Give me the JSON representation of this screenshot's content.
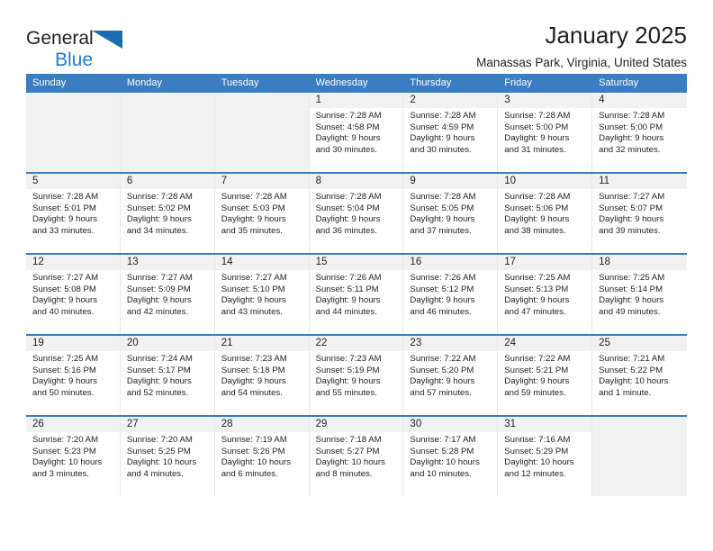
{
  "brand": {
    "name_primary": "General",
    "name_secondary": "Blue",
    "triangle_icon": "triangle-icon",
    "accent_color": "#1b7fd4"
  },
  "header": {
    "title": "January 2025",
    "subtitle": "Manassas Park, Virginia, United States"
  },
  "theme": {
    "header_bar_color": "#3b7dc0",
    "day_number_band_color": "#f1f1f1",
    "empty_cell_color": "#f1f1f1",
    "text_color": "#231f20"
  },
  "calendar": {
    "weekdays": [
      "Sunday",
      "Monday",
      "Tuesday",
      "Wednesday",
      "Thursday",
      "Friday",
      "Saturday"
    ],
    "labels": {
      "sunrise": "Sunrise:",
      "sunset": "Sunset:",
      "daylight": "Daylight:"
    },
    "weeks": [
      [
        {
          "empty": true
        },
        {
          "empty": true
        },
        {
          "empty": true
        },
        {
          "day": "1",
          "sunrise": "Sunrise: 7:28 AM",
          "sunset": "Sunset: 4:58 PM",
          "daylight_line1": "Daylight: 9 hours",
          "daylight_line2": "and 30 minutes."
        },
        {
          "day": "2",
          "sunrise": "Sunrise: 7:28 AM",
          "sunset": "Sunset: 4:59 PM",
          "daylight_line1": "Daylight: 9 hours",
          "daylight_line2": "and 30 minutes."
        },
        {
          "day": "3",
          "sunrise": "Sunrise: 7:28 AM",
          "sunset": "Sunset: 5:00 PM",
          "daylight_line1": "Daylight: 9 hours",
          "daylight_line2": "and 31 minutes."
        },
        {
          "day": "4",
          "sunrise": "Sunrise: 7:28 AM",
          "sunset": "Sunset: 5:00 PM",
          "daylight_line1": "Daylight: 9 hours",
          "daylight_line2": "and 32 minutes."
        }
      ],
      [
        {
          "day": "5",
          "sunrise": "Sunrise: 7:28 AM",
          "sunset": "Sunset: 5:01 PM",
          "daylight_line1": "Daylight: 9 hours",
          "daylight_line2": "and 33 minutes."
        },
        {
          "day": "6",
          "sunrise": "Sunrise: 7:28 AM",
          "sunset": "Sunset: 5:02 PM",
          "daylight_line1": "Daylight: 9 hours",
          "daylight_line2": "and 34 minutes."
        },
        {
          "day": "7",
          "sunrise": "Sunrise: 7:28 AM",
          "sunset": "Sunset: 5:03 PM",
          "daylight_line1": "Daylight: 9 hours",
          "daylight_line2": "and 35 minutes."
        },
        {
          "day": "8",
          "sunrise": "Sunrise: 7:28 AM",
          "sunset": "Sunset: 5:04 PM",
          "daylight_line1": "Daylight: 9 hours",
          "daylight_line2": "and 36 minutes."
        },
        {
          "day": "9",
          "sunrise": "Sunrise: 7:28 AM",
          "sunset": "Sunset: 5:05 PM",
          "daylight_line1": "Daylight: 9 hours",
          "daylight_line2": "and 37 minutes."
        },
        {
          "day": "10",
          "sunrise": "Sunrise: 7:28 AM",
          "sunset": "Sunset: 5:06 PM",
          "daylight_line1": "Daylight: 9 hours",
          "daylight_line2": "and 38 minutes."
        },
        {
          "day": "11",
          "sunrise": "Sunrise: 7:27 AM",
          "sunset": "Sunset: 5:07 PM",
          "daylight_line1": "Daylight: 9 hours",
          "daylight_line2": "and 39 minutes."
        }
      ],
      [
        {
          "day": "12",
          "sunrise": "Sunrise: 7:27 AM",
          "sunset": "Sunset: 5:08 PM",
          "daylight_line1": "Daylight: 9 hours",
          "daylight_line2": "and 40 minutes."
        },
        {
          "day": "13",
          "sunrise": "Sunrise: 7:27 AM",
          "sunset": "Sunset: 5:09 PM",
          "daylight_line1": "Daylight: 9 hours",
          "daylight_line2": "and 42 minutes."
        },
        {
          "day": "14",
          "sunrise": "Sunrise: 7:27 AM",
          "sunset": "Sunset: 5:10 PM",
          "daylight_line1": "Daylight: 9 hours",
          "daylight_line2": "and 43 minutes."
        },
        {
          "day": "15",
          "sunrise": "Sunrise: 7:26 AM",
          "sunset": "Sunset: 5:11 PM",
          "daylight_line1": "Daylight: 9 hours",
          "daylight_line2": "and 44 minutes."
        },
        {
          "day": "16",
          "sunrise": "Sunrise: 7:26 AM",
          "sunset": "Sunset: 5:12 PM",
          "daylight_line1": "Daylight: 9 hours",
          "daylight_line2": "and 46 minutes."
        },
        {
          "day": "17",
          "sunrise": "Sunrise: 7:25 AM",
          "sunset": "Sunset: 5:13 PM",
          "daylight_line1": "Daylight: 9 hours",
          "daylight_line2": "and 47 minutes."
        },
        {
          "day": "18",
          "sunrise": "Sunrise: 7:25 AM",
          "sunset": "Sunset: 5:14 PM",
          "daylight_line1": "Daylight: 9 hours",
          "daylight_line2": "and 49 minutes."
        }
      ],
      [
        {
          "day": "19",
          "sunrise": "Sunrise: 7:25 AM",
          "sunset": "Sunset: 5:16 PM",
          "daylight_line1": "Daylight: 9 hours",
          "daylight_line2": "and 50 minutes."
        },
        {
          "day": "20",
          "sunrise": "Sunrise: 7:24 AM",
          "sunset": "Sunset: 5:17 PM",
          "daylight_line1": "Daylight: 9 hours",
          "daylight_line2": "and 52 minutes."
        },
        {
          "day": "21",
          "sunrise": "Sunrise: 7:23 AM",
          "sunset": "Sunset: 5:18 PM",
          "daylight_line1": "Daylight: 9 hours",
          "daylight_line2": "and 54 minutes."
        },
        {
          "day": "22",
          "sunrise": "Sunrise: 7:23 AM",
          "sunset": "Sunset: 5:19 PM",
          "daylight_line1": "Daylight: 9 hours",
          "daylight_line2": "and 55 minutes."
        },
        {
          "day": "23",
          "sunrise": "Sunrise: 7:22 AM",
          "sunset": "Sunset: 5:20 PM",
          "daylight_line1": "Daylight: 9 hours",
          "daylight_line2": "and 57 minutes."
        },
        {
          "day": "24",
          "sunrise": "Sunrise: 7:22 AM",
          "sunset": "Sunset: 5:21 PM",
          "daylight_line1": "Daylight: 9 hours",
          "daylight_line2": "and 59 minutes."
        },
        {
          "day": "25",
          "sunrise": "Sunrise: 7:21 AM",
          "sunset": "Sunset: 5:22 PM",
          "daylight_line1": "Daylight: 10 hours",
          "daylight_line2": "and 1 minute."
        }
      ],
      [
        {
          "day": "26",
          "sunrise": "Sunrise: 7:20 AM",
          "sunset": "Sunset: 5:23 PM",
          "daylight_line1": "Daylight: 10 hours",
          "daylight_line2": "and 3 minutes."
        },
        {
          "day": "27",
          "sunrise": "Sunrise: 7:20 AM",
          "sunset": "Sunset: 5:25 PM",
          "daylight_line1": "Daylight: 10 hours",
          "daylight_line2": "and 4 minutes."
        },
        {
          "day": "28",
          "sunrise": "Sunrise: 7:19 AM",
          "sunset": "Sunset: 5:26 PM",
          "daylight_line1": "Daylight: 10 hours",
          "daylight_line2": "and 6 minutes."
        },
        {
          "day": "29",
          "sunrise": "Sunrise: 7:18 AM",
          "sunset": "Sunset: 5:27 PM",
          "daylight_line1": "Daylight: 10 hours",
          "daylight_line2": "and 8 minutes."
        },
        {
          "day": "30",
          "sunrise": "Sunrise: 7:17 AM",
          "sunset": "Sunset: 5:28 PM",
          "daylight_line1": "Daylight: 10 hours",
          "daylight_line2": "and 10 minutes."
        },
        {
          "day": "31",
          "sunrise": "Sunrise: 7:16 AM",
          "sunset": "Sunset: 5:29 PM",
          "daylight_line1": "Daylight: 10 hours",
          "daylight_line2": "and 12 minutes."
        },
        {
          "empty": true
        }
      ]
    ]
  }
}
